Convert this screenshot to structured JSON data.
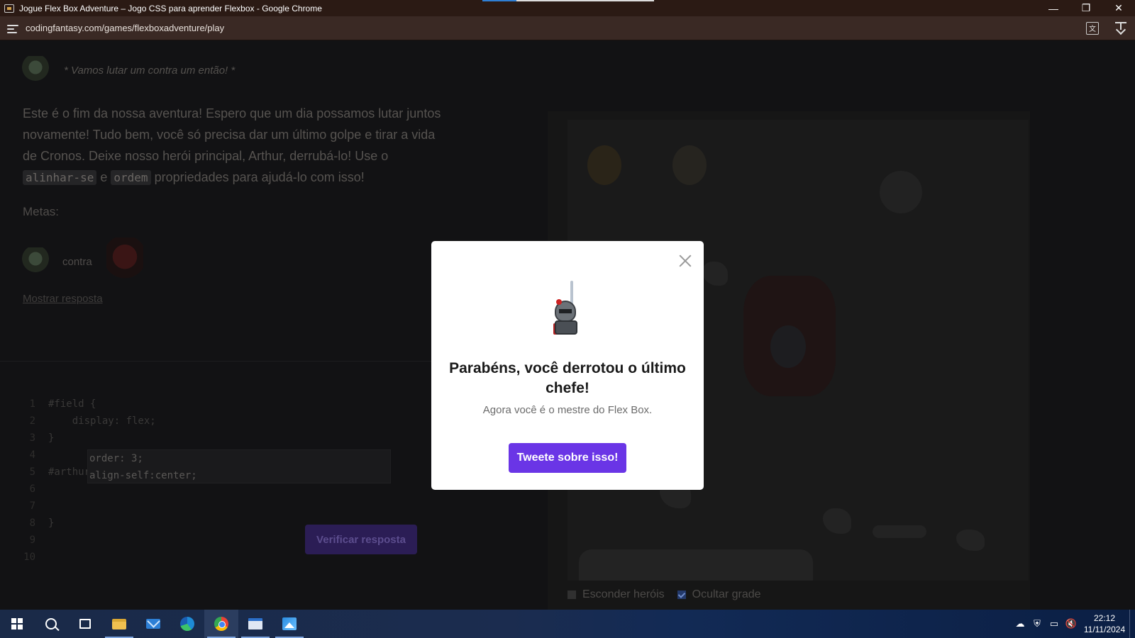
{
  "window": {
    "title": "Jogue Flex Box Adventure – Jogo CSS para aprender Flexbox - Google Chrome",
    "minimize_glyph": "—",
    "restore_glyph": "❐",
    "close_glyph": "✕"
  },
  "browser": {
    "url": "codingfantasy.com/games/flexboxadventure/play",
    "translate_icon": "translate-icon",
    "download_icon": "download-icon"
  },
  "level": {
    "dialog": "* Vamos lutar um contra um então! *",
    "story_part1": "Este é o fim da nossa aventura! Espero que um dia possamos lutar juntos novamente! Tudo bem, você só precisa dar um último golpe e tirar a vida de Cronos. Deixe nosso herói principal, Arthur, derrubá-lo! Use o",
    "chip1": "alinhar-se",
    "story_and": "e",
    "chip2": "ordem",
    "story_part2": "propriedades para ajudá-lo com isso!",
    "goals_label": "Metas:",
    "vs_label": "contra",
    "show_answer": "Mostrar resposta"
  },
  "editor": {
    "lines": [
      {
        "n": "1",
        "code": "#field {"
      },
      {
        "n": "2",
        "code": "    display: flex;"
      },
      {
        "n": "3",
        "code": "}"
      },
      {
        "n": "4",
        "code": ""
      },
      {
        "n": "5",
        "code": "#arthur {"
      },
      {
        "n": "6",
        "code": ""
      },
      {
        "n": "7",
        "code": ""
      },
      {
        "n": "8",
        "code": "}"
      },
      {
        "n": "9",
        "code": ""
      },
      {
        "n": "10",
        "code": ""
      }
    ],
    "input_lines": [
      "order: 3;",
      "align-self:center;"
    ],
    "check_button": "Verificar resposta"
  },
  "board_options": {
    "hide_heroes": "Esconder heróis",
    "hide_heroes_checked": false,
    "hide_grid": "Ocultar grade",
    "hide_grid_checked": true
  },
  "modal": {
    "title": "Parabéns, você derrotou o último chefe!",
    "subtitle": "Agora você é o mestre do Flex Box.",
    "button": "Tweete sobre isso!"
  },
  "taskbar": {
    "items": [
      "start",
      "search",
      "task-view",
      "file-explorer",
      "mail",
      "edge",
      "chrome",
      "app",
      "photos"
    ],
    "time": "22:12",
    "date": "11/11/2024"
  },
  "colors": {
    "accent": "#6a35e6",
    "overlay_dim": "#121214"
  }
}
